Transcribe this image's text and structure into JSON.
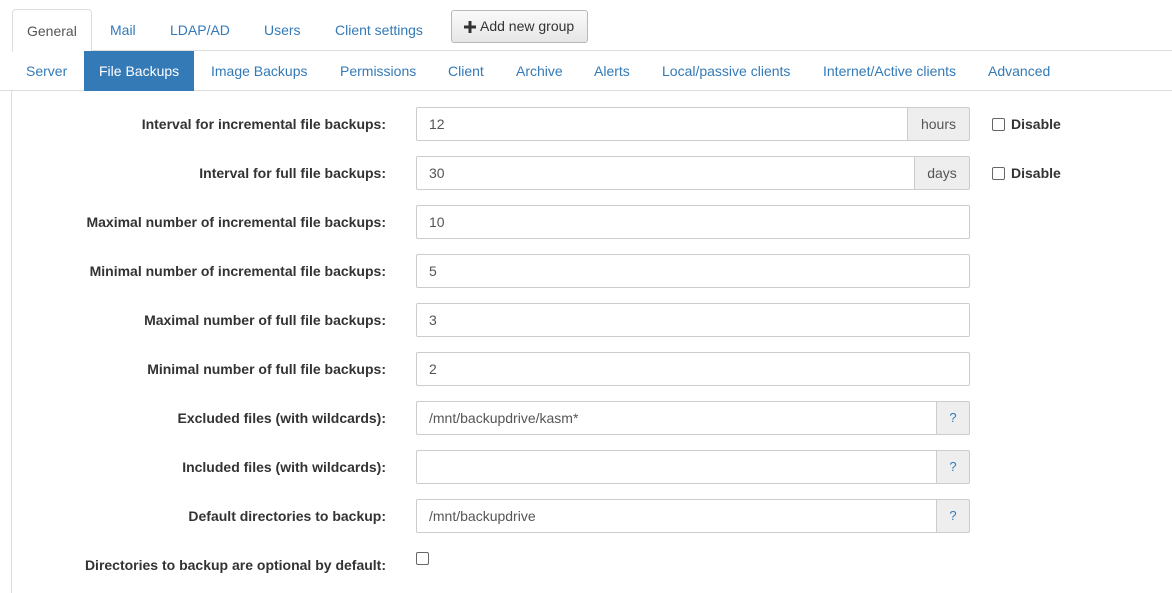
{
  "top_tabs": [
    "General",
    "Mail",
    "LDAP/AD",
    "Users",
    "Client settings"
  ],
  "add_group_label": "Add new group",
  "sub_tabs": [
    "Server",
    "File Backups",
    "Image Backups",
    "Permissions",
    "Client",
    "Archive",
    "Alerts",
    "Local/passive clients",
    "Internet/Active clients",
    "Advanced"
  ],
  "active_top_tab": "General",
  "active_sub_tab": "File Backups",
  "form": {
    "incr_interval": {
      "label": "Interval for incremental file backups:",
      "value": "12",
      "unit": "hours",
      "disable_label": "Disable",
      "disabled": false
    },
    "full_interval": {
      "label": "Interval for full file backups:",
      "value": "30",
      "unit": "days",
      "disable_label": "Disable",
      "disabled": false
    },
    "max_incr": {
      "label": "Maximal number of incremental file backups:",
      "value": "10"
    },
    "min_incr": {
      "label": "Minimal number of incremental file backups:",
      "value": "5"
    },
    "max_full": {
      "label": "Maximal number of full file backups:",
      "value": "3"
    },
    "min_full": {
      "label": "Minimal number of full file backups:",
      "value": "2"
    },
    "excluded": {
      "label": "Excluded files (with wildcards):",
      "value": "/mnt/backupdrive/kasm*",
      "help": "?"
    },
    "included": {
      "label": "Included files (with wildcards):",
      "value": "",
      "help": "?"
    },
    "default_dirs": {
      "label": "Default directories to backup:",
      "value": "/mnt/backupdrive",
      "help": "?"
    },
    "optional_default": {
      "label": "Directories to backup are optional by default:",
      "checked": false
    }
  },
  "colors": {
    "link": "#337ab7",
    "active_tab_bg": "#337ab7",
    "addon_bg": "#eeeeee",
    "border": "#cccccc"
  }
}
